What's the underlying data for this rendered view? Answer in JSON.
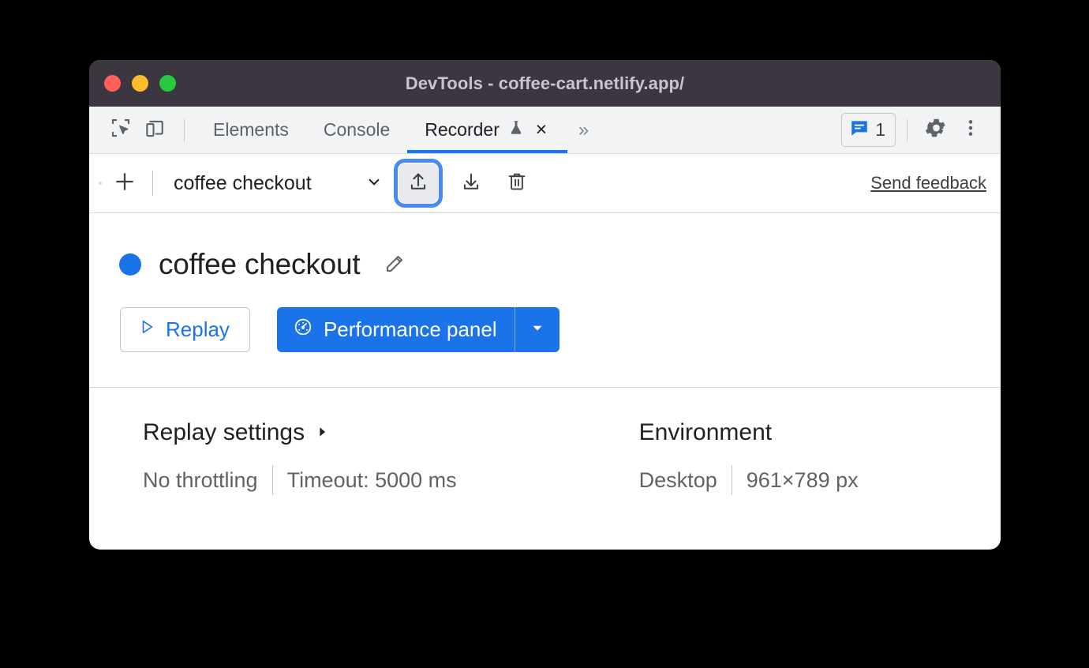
{
  "window": {
    "title": "DevTools - coffee-cart.netlify.app/",
    "traffic_lights": [
      {
        "name": "close",
        "color": "#ff6159"
      },
      {
        "name": "minimize",
        "color": "#ffbd2e"
      },
      {
        "name": "maximize",
        "color": "#28c940"
      }
    ]
  },
  "tabbar": {
    "inspect_icon": "inspect-element-icon",
    "device_icon": "device-toolbar-icon",
    "tabs": [
      {
        "label": "Elements",
        "active": false
      },
      {
        "label": "Console",
        "active": false
      },
      {
        "label": "Recorder",
        "active": true,
        "experimental": true,
        "closable": true
      }
    ],
    "more_tabs": "»",
    "close_glyph": "×",
    "issues": {
      "icon": "issues-message-icon",
      "count": "1"
    },
    "settings_icon": "gear-icon",
    "menu_icon": "kebab-menu-icon"
  },
  "recorder_toolbar": {
    "add_label": "add-recording-icon",
    "recording_name": "coffee checkout",
    "select_chevron": "chevron-down-icon",
    "export_icon": "export-upload-icon",
    "import_icon": "import-download-icon",
    "delete_icon": "trash-delete-icon",
    "feedback_label": "Send feedback",
    "focused_button": "export-upload-icon",
    "focus_ring_color": "#4a8af4"
  },
  "recording": {
    "status_color": "#1a73e8",
    "title": "coffee checkout",
    "edit_icon": "pencil-edit-icon",
    "replay_label": "Replay",
    "replay_icon": "play-triangle-icon",
    "performance_label": "Performance panel",
    "performance_icon": "gauge-speedometer-icon",
    "performance_arrow": "chevron-down-icon",
    "accent_color": "#1a73e8"
  },
  "settings": {
    "replay": {
      "heading": "Replay settings",
      "expander": "chevron-right-icon",
      "throttling": "No throttling",
      "timeout": "Timeout: 5000 ms"
    },
    "environment": {
      "heading": "Environment",
      "device": "Desktop",
      "viewport": "961×789 px"
    }
  }
}
